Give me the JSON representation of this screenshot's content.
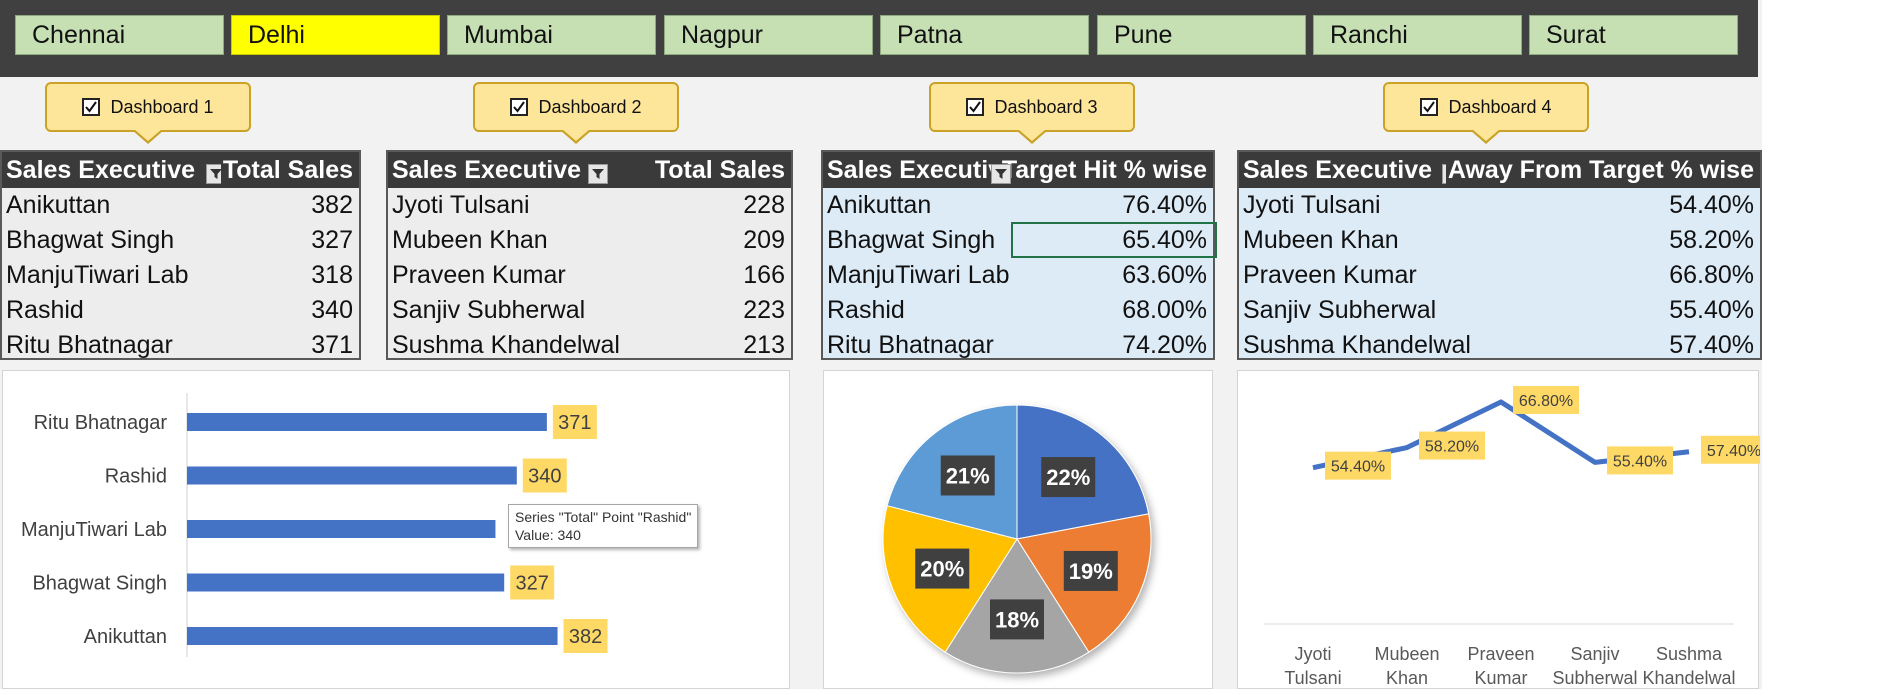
{
  "cities": {
    "selected": "Delhi",
    "items": [
      "Chennai",
      "Delhi",
      "Mumbai",
      "Nagpur",
      "Patna",
      "Pune",
      "Ranchi",
      "Surat"
    ]
  },
  "callouts": [
    "Dashboard 1",
    "Dashboard 2",
    "Dashboard 3",
    "Dashboard 4"
  ],
  "tables": {
    "t1": {
      "col1": "Sales Executive",
      "col2": "Total Sales",
      "rows": [
        {
          "name": "Anikuttan",
          "value": "382"
        },
        {
          "name": "Bhagwat Singh",
          "value": "327"
        },
        {
          "name": "ManjuTiwari Lab",
          "value": "318"
        },
        {
          "name": "Rashid",
          "value": "340"
        },
        {
          "name": "Ritu Bhatnagar",
          "value": "371"
        }
      ]
    },
    "t2": {
      "col1": "Sales Executive",
      "col2": "Total Sales",
      "rows": [
        {
          "name": "Jyoti Tulsani",
          "value": "228"
        },
        {
          "name": "Mubeen Khan",
          "value": "209"
        },
        {
          "name": "Praveen Kumar",
          "value": "166"
        },
        {
          "name": "Sanjiv Subherwal",
          "value": "223"
        },
        {
          "name": "Sushma Khandelwal",
          "value": "213"
        }
      ]
    },
    "t3": {
      "col1": "Sales Executive",
      "col2": "Target Hit % wise",
      "rows": [
        {
          "name": "Anikuttan",
          "value": "76.40%"
        },
        {
          "name": "Bhagwat Singh",
          "value": "65.40%"
        },
        {
          "name": "ManjuTiwari Lab",
          "value": "63.60%"
        },
        {
          "name": "Rashid",
          "value": "68.00%"
        },
        {
          "name": "Ritu Bhatnagar",
          "value": "74.20%"
        }
      ]
    },
    "t4": {
      "col1": "Sales Executive",
      "col2": "Away From Target % wise",
      "rows": [
        {
          "name": "Jyoti Tulsani",
          "value": "54.40%"
        },
        {
          "name": "Mubeen Khan",
          "value": "58.20%"
        },
        {
          "name": "Praveen Kumar",
          "value": "66.80%"
        },
        {
          "name": "Sanjiv Subherwal",
          "value": "55.40%"
        },
        {
          "name": "Sushma Khandelwal",
          "value": "57.40%"
        }
      ]
    }
  },
  "tooltip": {
    "line1": "Series \"Total\" Point \"Rashid\"",
    "line2": "Value: 340"
  },
  "colors": {
    "bar": "#4472c4",
    "label_bg": "#ffd966",
    "slicer_selected": "#ffff00",
    "slicer": "#c6e0b4"
  },
  "chart_data": [
    {
      "type": "bar",
      "orientation": "horizontal",
      "categories": [
        "Ritu Bhatnagar",
        "Rashid",
        "ManjuTiwari Lab",
        "Bhagwat Singh",
        "Anikuttan"
      ],
      "series": [
        {
          "name": "Total",
          "values": [
            371,
            340,
            318,
            327,
            382
          ]
        }
      ],
      "data_labels": [
        "371",
        "340",
        "",
        "327",
        "382"
      ],
      "xlim": [
        0,
        500
      ]
    },
    {
      "type": "pie",
      "categories": [
        "Anikuttan",
        "Bhagwat Singh",
        "ManjuTiwari Lab",
        "Rashid",
        "Ritu Bhatnagar"
      ],
      "values": [
        22,
        19,
        18,
        20,
        21
      ],
      "labels": [
        "22%",
        "19%",
        "18%",
        "20%",
        "21%"
      ],
      "colors": [
        "#4472c4",
        "#ed7d31",
        "#a5a5a5",
        "#ffc000",
        "#5b9bd5"
      ]
    },
    {
      "type": "line",
      "categories": [
        "Jyoti Tulsani",
        "Mubeen Khan",
        "Praveen Kumar",
        "Sanjiv Subherwal",
        "Sushma Khandelwal"
      ],
      "values": [
        54.4,
        58.2,
        66.8,
        55.4,
        57.4
      ],
      "labels": [
        "54.40%",
        "58.20%",
        "66.80%",
        "55.40%",
        "57.40%"
      ],
      "ylim": [
        0,
        100
      ]
    }
  ]
}
